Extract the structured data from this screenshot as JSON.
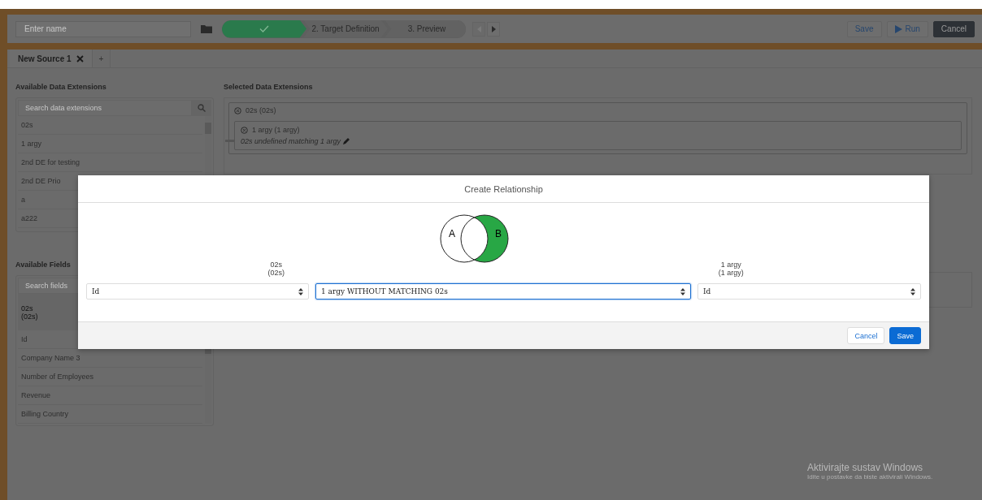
{
  "toolbar": {
    "name_field": {
      "placeholder": "Enter name"
    },
    "steps": [
      {
        "completed": true
      },
      {
        "label": "2. Target Definition",
        "completed": false
      },
      {
        "label": "3. Preview",
        "completed": false
      }
    ],
    "nav": [
      {
        "disabled": true
      },
      {
        "disabled": false
      }
    ],
    "buttons": [
      {
        "label": "Save",
        "kind": "plain"
      },
      {
        "label": "Run",
        "kind": "run"
      },
      {
        "label": "Cancel",
        "kind": "dark"
      }
    ]
  },
  "tabs": [
    {
      "label": "New Source 1",
      "selected": true,
      "closable": true
    }
  ],
  "add_tab": "+",
  "available_data_extensions": {
    "title": "Available Data Extensions",
    "search": {
      "placeholder": "Search data extensions"
    },
    "items": [
      "02s",
      "1 argy",
      "2nd DE for testing",
      "2nd DE Prio",
      "a",
      "a222"
    ]
  },
  "available_fields": {
    "title": "Available Fields",
    "search": {
      "placeholder": "Search fields"
    },
    "group": [
      "02s",
      "(02s)"
    ],
    "items": [
      "Id",
      "Company Name 3",
      "Number of Employees",
      "Revenue",
      "Billing Country"
    ]
  },
  "selected_data_extensions": {
    "title": "Selected Data Extensions",
    "root": {
      "label": "02s (02s)",
      "children": [
        {
          "label": "1 argy (1 argy)",
          "relationship": "02s undefined matching 1 argy"
        }
      ]
    }
  },
  "modal": {
    "title": "Create Relationship",
    "left": {
      "name": "02s",
      "subtitle": "(02s)",
      "field": "Id"
    },
    "venn": {
      "labels": [
        "A",
        "B"
      ],
      "filled": {
        "a_only": false,
        "intersection": false,
        "b_only": true
      }
    },
    "join": {
      "value": "1 argy WITHOUT MATCHING 02s",
      "focused": true
    },
    "right": {
      "name": "1 argy",
      "subtitle": "(1 argy)",
      "field": "Id"
    },
    "buttons": [
      {
        "label": "Cancel",
        "kind": "neutral"
      },
      {
        "label": "Save",
        "kind": "primary"
      }
    ]
  },
  "system_notice": {
    "title": "Aktivirajte sustav Windows",
    "text": "Idite u postavke da biste aktivirali Windows."
  }
}
